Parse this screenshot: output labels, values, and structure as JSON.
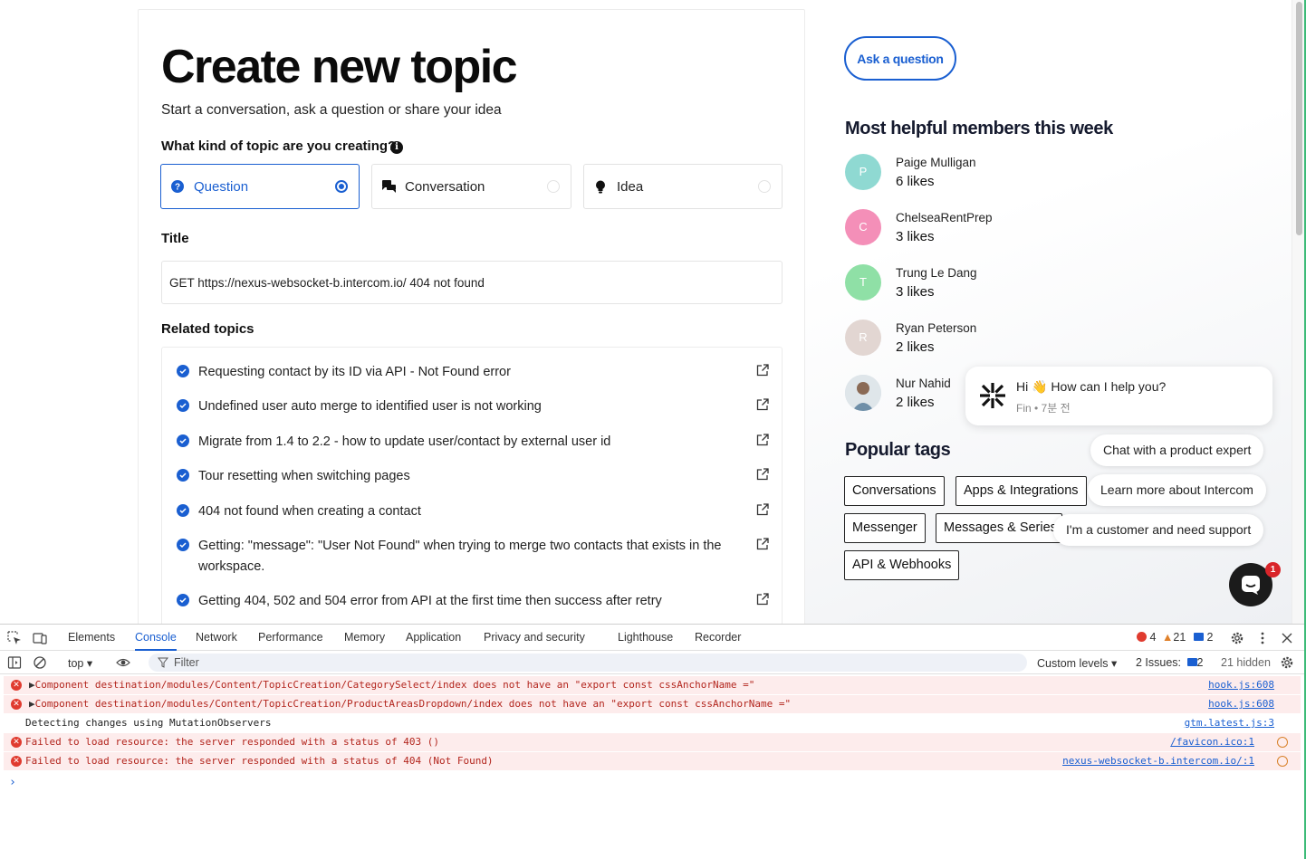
{
  "form": {
    "heading": "Create new topic",
    "subtitle": "Start a conversation, ask a question or share your idea",
    "kind_label": "What kind of topic are you creating?",
    "types": [
      {
        "label": "Question",
        "selected": true,
        "icon": "question-circle-icon"
      },
      {
        "label": "Conversation",
        "selected": false,
        "icon": "chat-bubbles-icon"
      },
      {
        "label": "Idea",
        "selected": false,
        "icon": "lightbulb-icon"
      }
    ],
    "title_label": "Title",
    "title_value": "GET https://nexus-websocket-b.intercom.io/ 404 not found",
    "related_label": "Related topics",
    "related": [
      "Requesting contact by its ID via API - Not Found error",
      "Undefined user auto merge to identified user is not working",
      "Migrate from 1.4 to 2.2 - how to update user/contact by external user id",
      "Tour resetting when switching pages",
      "404 not found when creating a contact",
      "Getting: \"message\": \"User Not Found\" when trying to merge two contacts that exists in the workspace.",
      "Getting 404, 502 and 504 error from API at the first time then success after retry"
    ]
  },
  "sidebar": {
    "ask_button": "Ask a question",
    "helpful_heading": "Most helpful members this week",
    "members": [
      {
        "initial": "P",
        "name": "Paige Mulligan",
        "likes": "6 likes",
        "color": "#8fd9d2"
      },
      {
        "initial": "C",
        "name": "ChelseaRentPrep",
        "likes": "3 likes",
        "color": "#f48fb8"
      },
      {
        "initial": "T",
        "name": "Trung Le Dang",
        "likes": "3 likes",
        "color": "#8fe0a6"
      },
      {
        "initial": "R",
        "name": "Ryan Peterson",
        "likes": "2 likes",
        "color": "#e2d6d2"
      },
      {
        "initial": "",
        "name": "Nur Nahid",
        "likes": "2 likes",
        "color": "#9fb6c8"
      }
    ],
    "tags_heading": "Popular tags",
    "tags": [
      "Conversations",
      "Apps & Integrations",
      "Messenger",
      "Messages & Series",
      "API & Webhooks"
    ]
  },
  "messenger": {
    "greeting": "Hi 👋 How can I help you?",
    "meta": "Fin • 7분 전",
    "quick_replies": [
      "Chat with a product expert",
      "Learn more about Intercom",
      "I'm a customer and need support"
    ],
    "badge_count": "1"
  },
  "devtools": {
    "tabs": [
      "Elements",
      "Console",
      "Network",
      "Performance",
      "Memory",
      "Application",
      "Privacy and security",
      "Lighthouse",
      "Recorder"
    ],
    "active_tab": "Console",
    "error_count": "4",
    "warning_count": "21",
    "info_count": "2",
    "context": "top",
    "filter_placeholder": "Filter",
    "levels": "Custom levels",
    "issues_label": "2 Issues:",
    "issues_count": "2",
    "hidden": "21 hidden",
    "logs": [
      {
        "type": "error",
        "expandable": true,
        "message": "Component destination/modules/Content/TopicCreation/CategorySelect/index does not have an \"export const cssAnchorName =\"",
        "source": "hook.js:608"
      },
      {
        "type": "error",
        "expandable": true,
        "message": "Component destination/modules/Content/TopicCreation/ProductAreasDropdown/index does not have an \"export const cssAnchorName =\"",
        "source": "hook.js:608"
      },
      {
        "type": "info",
        "expandable": false,
        "message": "Detecting changes using MutationObservers",
        "source": "gtm.latest.js:3"
      },
      {
        "type": "error",
        "expandable": false,
        "message": "Failed to load resource: the server responded with a status of 403 ()",
        "source": "/favicon.ico:1"
      },
      {
        "type": "error",
        "expandable": false,
        "message": "Failed to load resource: the server responded with a status of 404 (Not Found)",
        "source": "nexus-websocket-b.intercom.io/:1"
      }
    ],
    "prompt": "›"
  }
}
